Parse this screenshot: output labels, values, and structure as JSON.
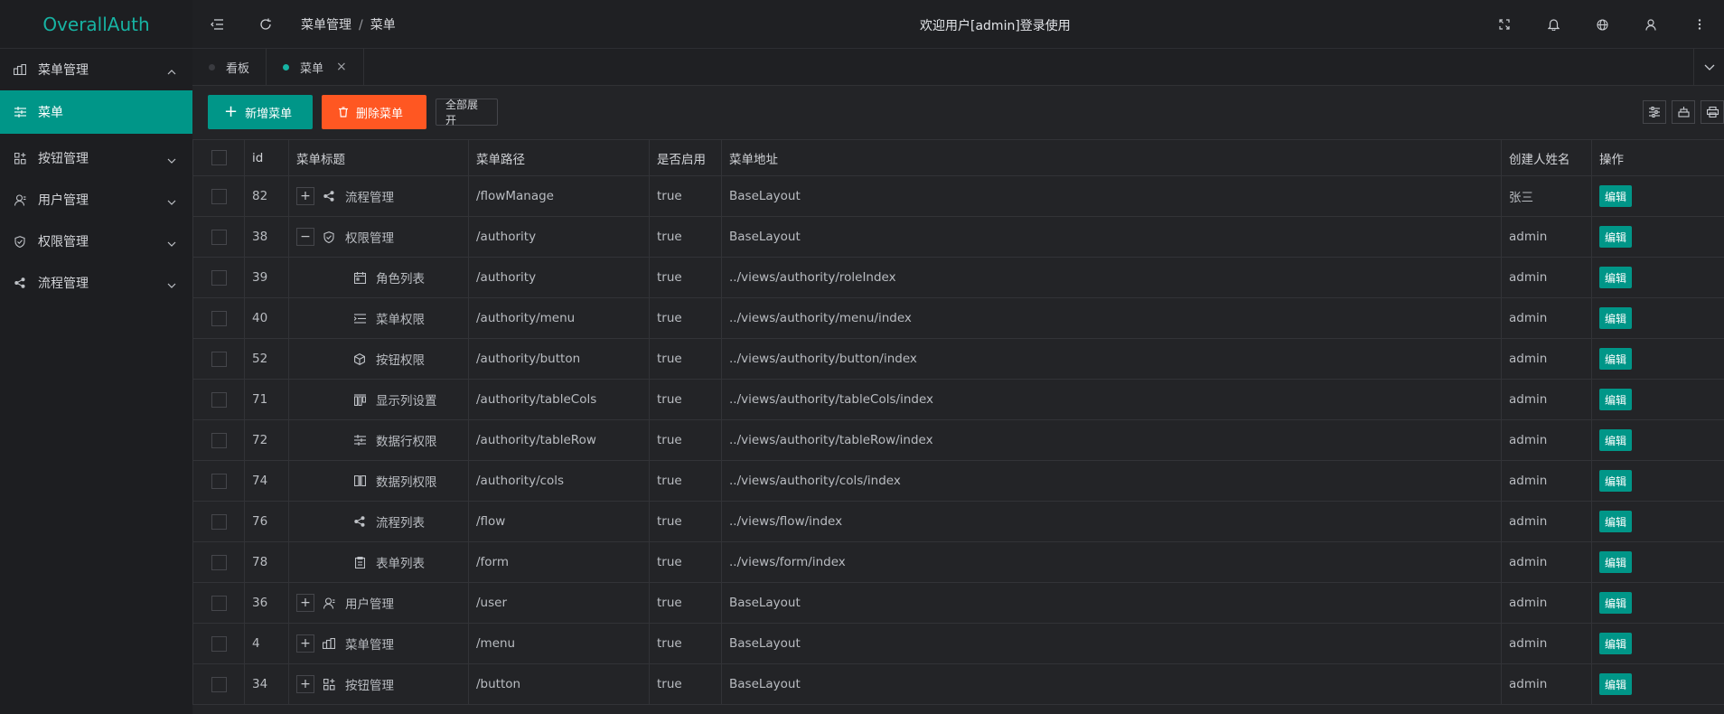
{
  "app": {
    "title": "OverallAuth"
  },
  "sidebar": {
    "items": [
      {
        "label": "菜单管理",
        "icon": "menu-manage-icon",
        "state": "expanded"
      },
      {
        "label": "菜单",
        "icon": "sliders-icon",
        "state": "active"
      },
      {
        "label": "按钮管理",
        "icon": "button-manage-icon",
        "state": "collapsed"
      },
      {
        "label": "用户管理",
        "icon": "user-icon",
        "state": "collapsed"
      },
      {
        "label": "权限管理",
        "icon": "shield-icon",
        "state": "collapsed"
      },
      {
        "label": "流程管理",
        "icon": "share-icon",
        "state": "collapsed"
      }
    ]
  },
  "header": {
    "breadcrumb": [
      "菜单管理",
      "菜单"
    ],
    "breadcrumb_sep": "/",
    "welcome": "欢迎用户[admin]登录使用"
  },
  "tabs": [
    {
      "label": "看板",
      "active": false
    },
    {
      "label": "菜单",
      "active": true,
      "close": "×"
    }
  ],
  "toolbar": {
    "add_label": "新增菜单",
    "delete_label": "删除菜单",
    "expand_label": "全部展开"
  },
  "table": {
    "columns": [
      "id",
      "菜单标题",
      "菜单路径",
      "是否启用",
      "菜单地址",
      "创建人姓名",
      "操作"
    ],
    "edit_label": "编辑",
    "rows": [
      {
        "id": "82",
        "title": "流程管理",
        "path": "/flowManage",
        "enabled": "true",
        "address": "BaseLayout",
        "creator": "张三",
        "level": 0,
        "toggle": "+",
        "icon": "share-icon"
      },
      {
        "id": "38",
        "title": "权限管理",
        "path": "/authority",
        "enabled": "true",
        "address": "BaseLayout",
        "creator": "admin",
        "level": 0,
        "toggle": "−",
        "icon": "shield-icon"
      },
      {
        "id": "39",
        "title": "角色列表",
        "path": "/authority",
        "enabled": "true",
        "address": "../views/authority/roleIndex",
        "creator": "admin",
        "level": 1,
        "icon": "calendar-icon"
      },
      {
        "id": "40",
        "title": "菜单权限",
        "path": "/authority/menu",
        "enabled": "true",
        "address": "../views/authority/menu/index",
        "creator": "admin",
        "level": 1,
        "icon": "list-indent-icon"
      },
      {
        "id": "52",
        "title": "按钮权限",
        "path": "/authority/button",
        "enabled": "true",
        "address": "../views/authority/button/index",
        "creator": "admin",
        "level": 1,
        "icon": "cube-icon"
      },
      {
        "id": "71",
        "title": "显示列设置",
        "path": "/authority/tableCols",
        "enabled": "true",
        "address": "../views/authority/tableCols/index",
        "creator": "admin",
        "level": 1,
        "icon": "columns-icon"
      },
      {
        "id": "72",
        "title": "数据行权限",
        "path": "/authority/tableRow",
        "enabled": "true",
        "address": "../views/authority/tableRow/index",
        "creator": "admin",
        "level": 1,
        "icon": "sliders-icon"
      },
      {
        "id": "74",
        "title": "数据列权限",
        "path": "/authority/cols",
        "enabled": "true",
        "address": "../views/authority/cols/index",
        "creator": "admin",
        "level": 1,
        "icon": "split-columns-icon"
      },
      {
        "id": "76",
        "title": "流程列表",
        "path": "/flow",
        "enabled": "true",
        "address": "../views/flow/index",
        "creator": "admin",
        "level": 1,
        "icon": "share-icon"
      },
      {
        "id": "78",
        "title": "表单列表",
        "path": "/form",
        "enabled": "true",
        "address": "../views/form/index",
        "creator": "admin",
        "level": 1,
        "icon": "clipboard-icon"
      },
      {
        "id": "36",
        "title": "用户管理",
        "path": "/user",
        "enabled": "true",
        "address": "BaseLayout",
        "creator": "admin",
        "level": 0,
        "toggle": "+",
        "icon": "user-icon"
      },
      {
        "id": "4",
        "title": "菜单管理",
        "path": "/menu",
        "enabled": "true",
        "address": "BaseLayout",
        "creator": "admin",
        "level": 0,
        "toggle": "+",
        "icon": "menu-manage-icon"
      },
      {
        "id": "34",
        "title": "按钮管理",
        "path": "/button",
        "enabled": "true",
        "address": "BaseLayout",
        "creator": "admin",
        "level": 0,
        "toggle": "+",
        "icon": "button-manage-icon"
      }
    ]
  },
  "colors": {
    "accent": "#009688",
    "danger": "#ff5722",
    "logo": "#17b3a3"
  }
}
